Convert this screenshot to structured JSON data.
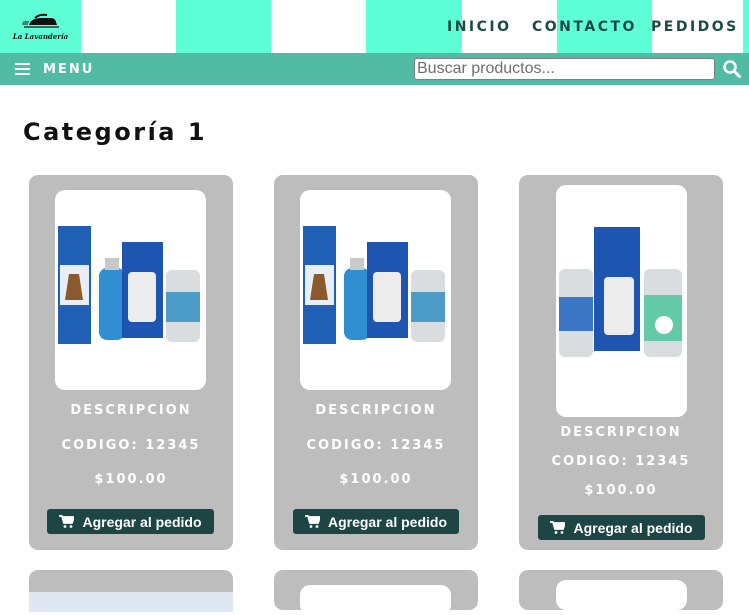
{
  "brand": {
    "name": "La Lavandería"
  },
  "nav": {
    "items": [
      "INICIO",
      "CONTACTO",
      "PEDIDOS"
    ]
  },
  "menubar": {
    "menu_label": "MENU",
    "search_placeholder": "Buscar productos..."
  },
  "colors": {
    "accent": "#5effd6",
    "menubar": "#52bba4",
    "card": "#bdbdbd",
    "button": "#1c4544"
  },
  "category": {
    "title": "Categoría 1"
  },
  "products": [
    {
      "description": "DESCRIPCION",
      "code": "CODIGO: 12345",
      "price": "$100.00",
      "button": "Agregar al pedido"
    },
    {
      "description": "DESCRIPCION",
      "code": "CODIGO: 12345",
      "price": "$100.00",
      "button": "Agregar al pedido"
    },
    {
      "description": "DESCRIPCION",
      "code": "CODIGO: 12345",
      "price": "$100.00",
      "button": "Agregar al pedido"
    }
  ]
}
